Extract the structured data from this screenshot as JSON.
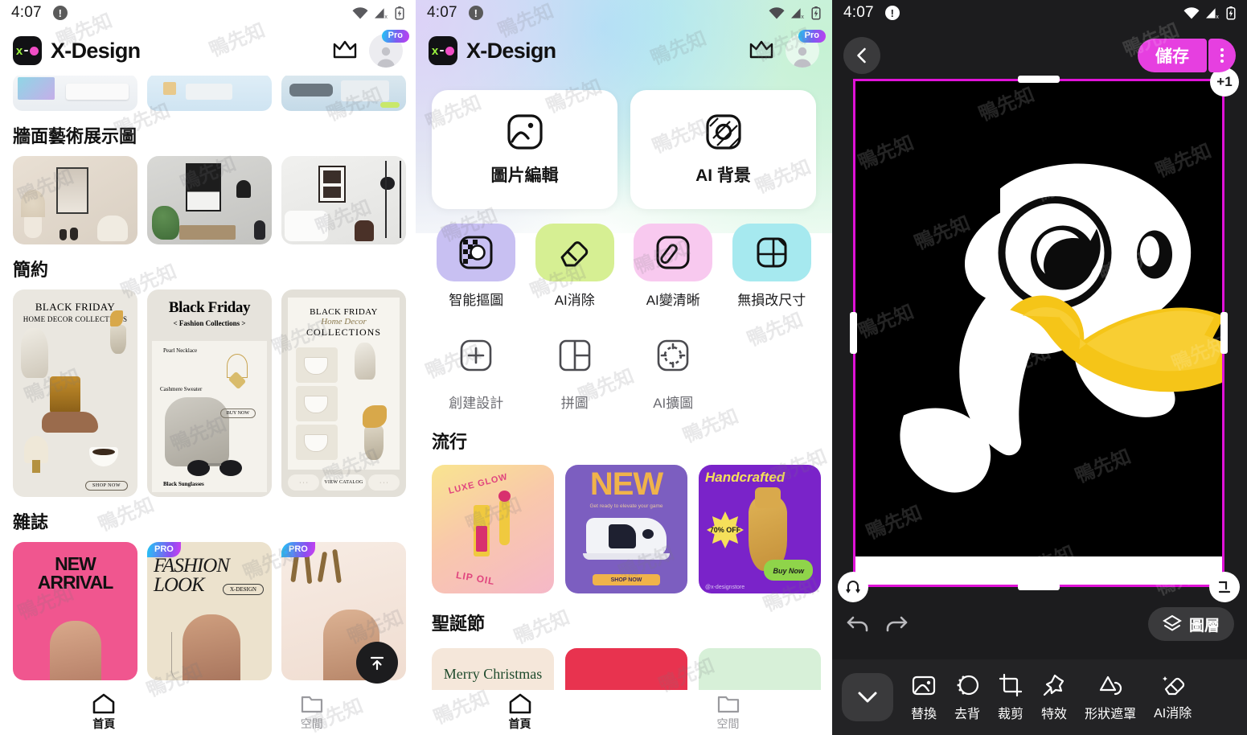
{
  "colors": {
    "accent_magenta": "#e63fe0",
    "selection_border": "#e012d8",
    "dark_bg": "#1c1c1e",
    "toolbar_bg": "#232325",
    "pro_gradient_start": "#1fc8f5",
    "pro_gradient_end": "#c23ef0",
    "logo_green": "#9cf53f",
    "logo_pink": "#f14ec6"
  },
  "status_bar": {
    "time": "4:07",
    "alert_icon": "exclamation-circle-icon",
    "wifi_icon": "wifi-icon",
    "cellular_icon": "cellular-no-service-icon",
    "battery_icon": "battery-charging-icon"
  },
  "panels": [
    {
      "id": "home-browse",
      "header": {
        "logo_icon": "x-design-logo-icon",
        "brand": "X-Design",
        "crown_icon": "crown-icon",
        "avatar_icon": "avatar-icon",
        "pro_badge": "Pro"
      },
      "sections": [
        {
          "title": "",
          "kind": "partial-row",
          "items": [
            "keyboard-mockup",
            "interior-mockup",
            "desk-mockup",
            "edge-mockup"
          ]
        },
        {
          "title": "牆面藝術展示圖",
          "kind": "rooms",
          "items": [
            "beige-room-art-frame",
            "concrete-wall-art-frame",
            "white-brick-bedroom-art",
            "green-plant-edge"
          ]
        },
        {
          "title": "簡約",
          "kind": "templates",
          "items": [
            {
              "line1": "BLACK FRIDAY",
              "line2": "HOME DECOR COLLECTIONS",
              "cta": "SHOP NOW"
            },
            {
              "line1": "Black Friday",
              "line2": "< Fashion Collections >",
              "cta": "BUY NOW",
              "labels": [
                "Pearl Necklace",
                "Cashmere Sweater",
                "Black Sunglasses"
              ]
            },
            {
              "line1": "BLACK FRIDAY",
              "line2": "Home Decor",
              "line3": "COLLECTIONS",
              "cta": "VIEW CATALOG"
            }
          ]
        },
        {
          "title": "雜誌",
          "kind": "magazines",
          "items": [
            {
              "title": "NEW ARRIVAL",
              "badge": ""
            },
            {
              "title": "FASHION LOOK",
              "sub": "X-DESIGN",
              "badge": "PRO"
            },
            {
              "title": "",
              "badge": "PRO"
            }
          ]
        }
      ],
      "fab_icon": "scroll-to-top-icon",
      "bottom_nav": [
        {
          "label": "首頁",
          "icon": "home-icon",
          "active": true
        },
        {
          "label": "空間",
          "icon": "folder-icon",
          "active": false
        }
      ]
    },
    {
      "id": "home-tools",
      "header": {
        "logo_icon": "x-design-logo-icon",
        "brand": "X-Design",
        "crown_icon": "crown-icon",
        "avatar_icon": "avatar-icon",
        "pro_badge": "Pro"
      },
      "primary_tools": [
        {
          "label": "圖片編輯",
          "icon": "image-edit-icon"
        },
        {
          "label": "AI 背景",
          "icon": "ai-background-icon"
        }
      ],
      "tool_grid_row1": [
        {
          "label": "智能摳圖",
          "icon": "smart-cutout-icon",
          "tile": "#c8c0f2"
        },
        {
          "label": "AI消除",
          "icon": "eraser-icon",
          "tile": "#d6ef93"
        },
        {
          "label": "AI變清晰",
          "icon": "magic-wand-icon",
          "tile": "#f8c9ef"
        },
        {
          "label": "無損改尺寸",
          "icon": "resize-icon",
          "tile": "#a6e9ef"
        }
      ],
      "tool_grid_row2": [
        {
          "label": "創建設計",
          "icon": "plus-square-icon"
        },
        {
          "label": "拼圖",
          "icon": "collage-icon"
        },
        {
          "label": "AI擴圖",
          "icon": "expand-image-icon"
        }
      ],
      "sections": [
        {
          "title": "流行",
          "items": [
            {
              "title": "LUXE GLOW",
              "sub": "LIP OIL"
            },
            {
              "title": "NEW",
              "sub": "Get ready to elevate your game",
              "cta": "SHOP NOW"
            },
            {
              "title": "Handcrafted",
              "badge": "70% OFF",
              "cta": "Buy Now",
              "handle": "@x-designstore"
            },
            {
              "title": ""
            }
          ]
        },
        {
          "title": "聖誕節",
          "items": [
            {
              "title": "Merry Christmas"
            },
            {
              "title": ""
            },
            {
              "title": ""
            },
            {
              "title": ""
            }
          ]
        }
      ],
      "bottom_nav": [
        {
          "label": "首頁",
          "icon": "home-icon",
          "active": true
        },
        {
          "label": "空間",
          "icon": "folder-icon",
          "active": false
        }
      ]
    },
    {
      "id": "editor",
      "top_bar": {
        "back_icon": "chevron-left-icon",
        "save_label": "儲存",
        "more_icon": "kebab-menu-icon",
        "layer_count_badge": "+1"
      },
      "canvas": {
        "subject": "white-duck-mascot-yellow-beak",
        "background": "#000000",
        "selection_active": true,
        "handles": [
          "top-center",
          "left-center",
          "right-center",
          "bottom-center",
          "bottom-left-rotate",
          "bottom-right-resize"
        ]
      },
      "mid_bar": {
        "undo_icon": "undo-icon",
        "redo_icon": "redo-icon",
        "layers_label": "圖層",
        "layers_icon": "layers-icon"
      },
      "toolbar": {
        "collapse_icon": "chevron-down-icon",
        "items": [
          {
            "label": "替換",
            "icon": "replace-image-icon"
          },
          {
            "label": "去背",
            "icon": "remove-background-icon"
          },
          {
            "label": "裁剪",
            "icon": "crop-icon"
          },
          {
            "label": "特效",
            "icon": "effects-star-icon"
          },
          {
            "label": "形狀遮罩",
            "icon": "shape-mask-icon"
          },
          {
            "label": "AI消除",
            "icon": "ai-eraser-icon"
          }
        ]
      }
    }
  ],
  "watermark": {
    "text": "鴨先知",
    "opacity": 0.17
  }
}
